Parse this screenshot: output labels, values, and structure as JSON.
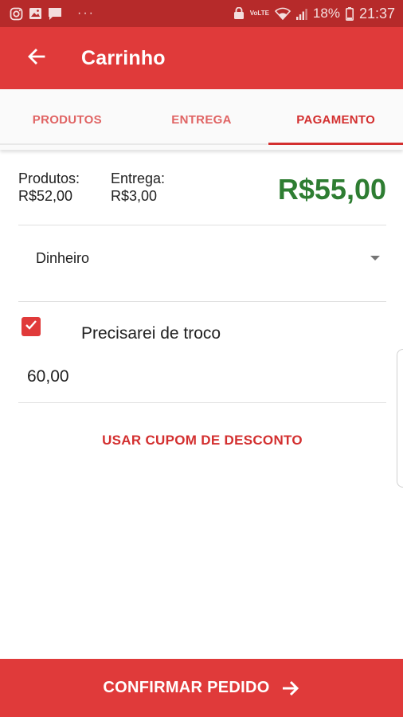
{
  "status_bar": {
    "icons_left": [
      "instagram-icon",
      "image-icon",
      "message-icon"
    ],
    "overflow": "···",
    "volte": "VoLTE",
    "battery": "18%",
    "time": "21:37"
  },
  "app_bar": {
    "title": "Carrinho",
    "background": "#e03a3a"
  },
  "tabs": [
    {
      "label": "PRODUTOS",
      "active": false
    },
    {
      "label": "ENTREGA",
      "active": false
    },
    {
      "label": "PAGAMENTO",
      "active": true
    }
  ],
  "summary": {
    "products_label": "Produtos:",
    "products_value": "R$52,00",
    "delivery_label": "Entrega:",
    "delivery_value": "R$3,00",
    "total": "R$55,00",
    "total_color": "#2e7d32"
  },
  "payment": {
    "selected": "Dinheiro"
  },
  "change": {
    "checked": true,
    "label": "Precisarei de troco",
    "amount": "60,00"
  },
  "coupon": {
    "label": "USAR CUPOM DE DESCONTO"
  },
  "confirm": {
    "label": "CONFIRMAR PEDIDO"
  }
}
